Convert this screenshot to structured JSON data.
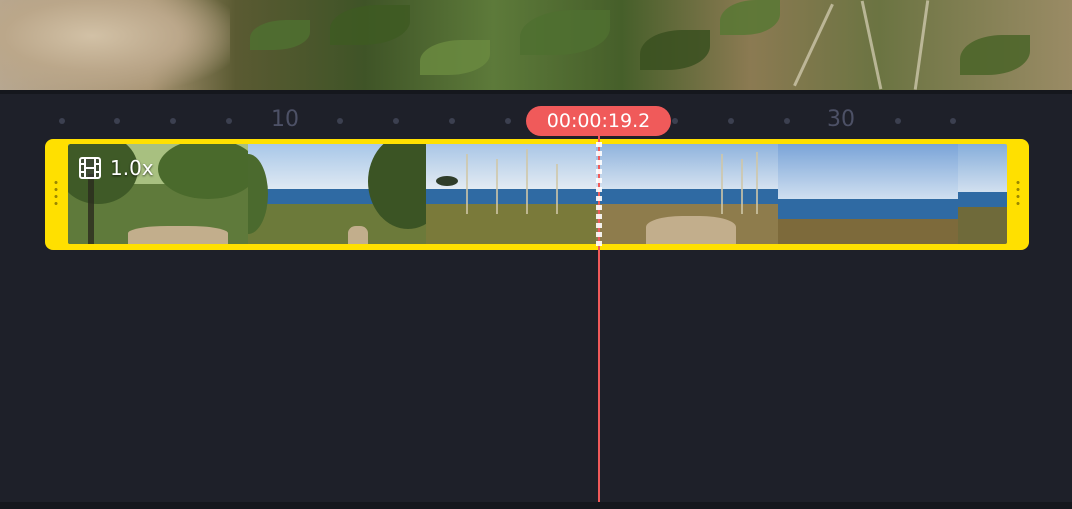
{
  "ruler": {
    "labels": [
      "10",
      "30"
    ]
  },
  "playhead": {
    "time": "00:00:19.2",
    "color": "#f05a5a"
  },
  "clip": {
    "speed": "1.0x",
    "accent_color": "#ffe000",
    "speed_icon": "film-icon"
  },
  "colors": {
    "background": "#1e2029",
    "ruler_text": "#4d5166"
  }
}
